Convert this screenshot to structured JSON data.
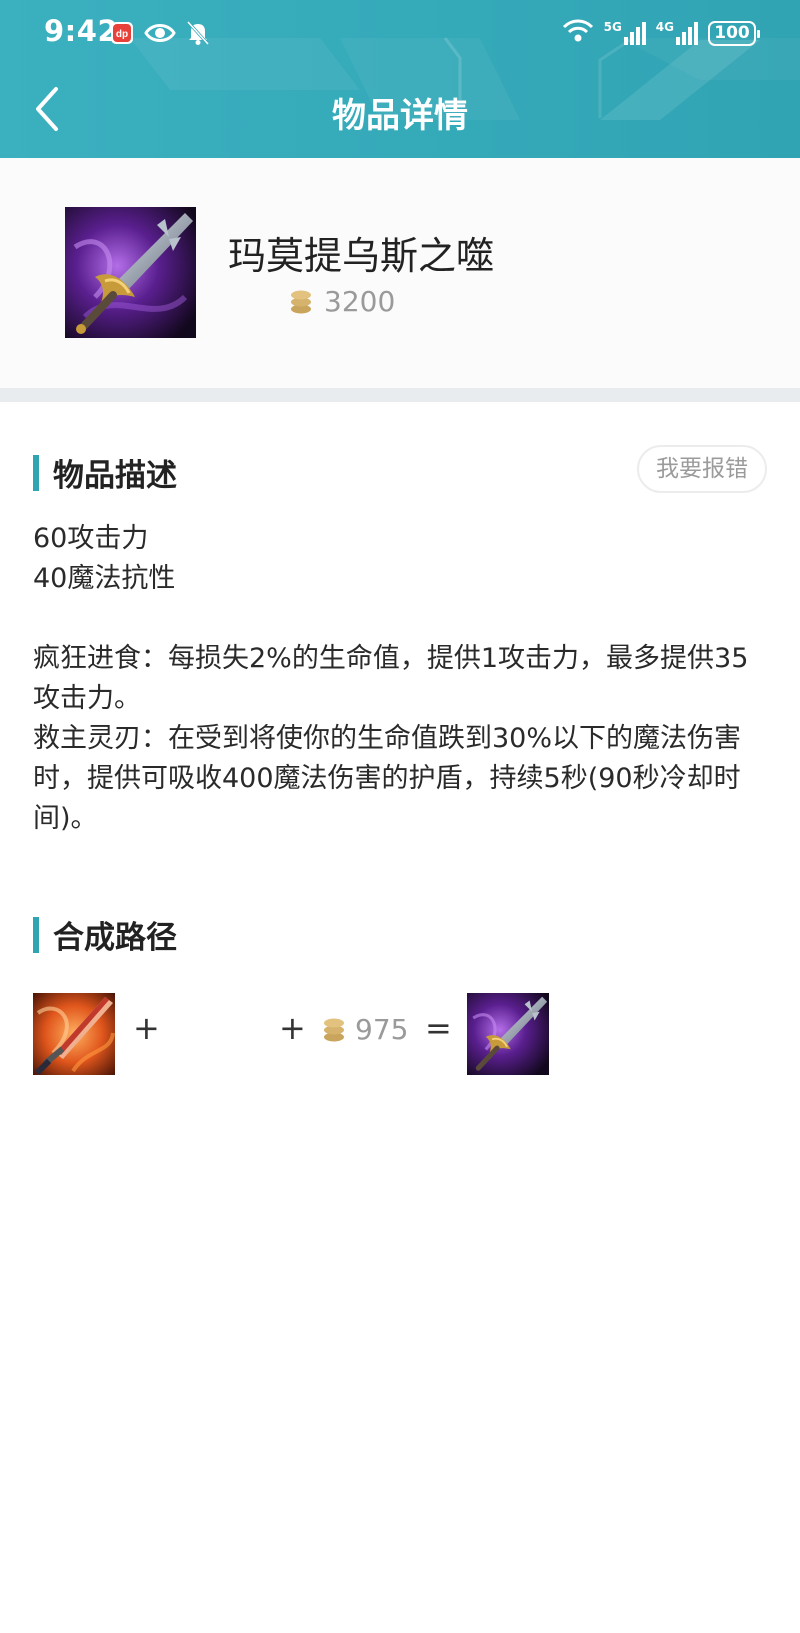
{
  "status_bar": {
    "time": "9:42",
    "left_icons": [
      "dianping-app-icon",
      "eye-icon",
      "bell-off-icon"
    ],
    "network_1": "5G",
    "network_2": "4G",
    "battery": "100"
  },
  "header": {
    "title": "物品详情",
    "back_icon": "chevron-left-icon"
  },
  "item": {
    "name": "玛莫提乌斯之噬",
    "price": "3200",
    "price_icon": "gold-coins-icon"
  },
  "description_section": {
    "title": "物品描述",
    "report_button": "我要报错",
    "lines": [
      "60攻击力",
      "40魔法抗性",
      "",
      "疯狂进食：每损失2%的生命值，提供1攻击力，最多提供35攻击力。",
      "救主灵刃：在受到将使你的生命值跌到30%以下的魔法伤害时，提供可吸收400魔法伤害的护盾，持续5秒(90秒冷却时间)。"
    ]
  },
  "build_section": {
    "title": "合成路径",
    "plus_1": "+",
    "plus_2": "+",
    "cost": "975",
    "equals": "="
  },
  "colors": {
    "header": "#35aab9",
    "accent": "#2fa5b3",
    "gold": "#c9a45c"
  }
}
